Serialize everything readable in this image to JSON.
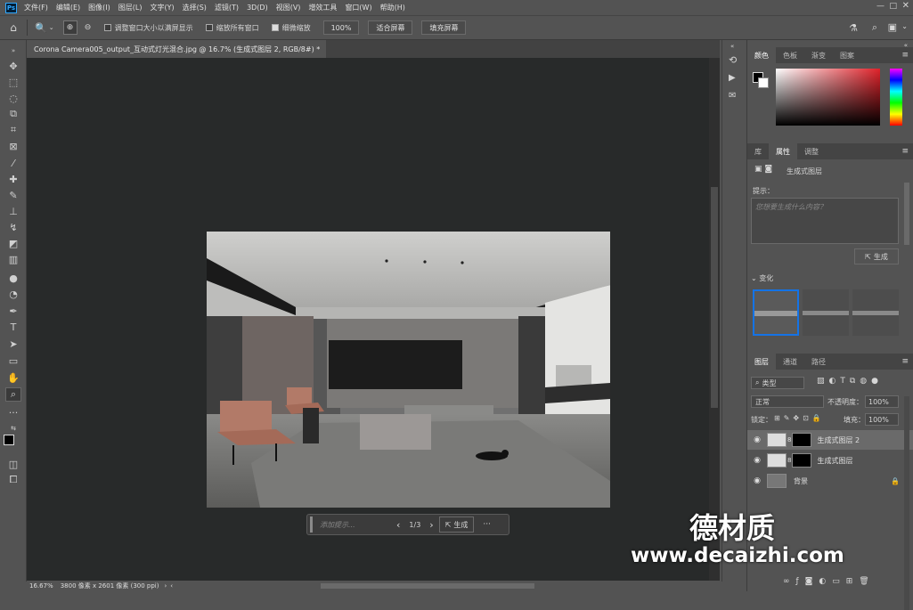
{
  "app": {
    "logo": "Ps"
  },
  "menu": [
    "文件(F)",
    "编辑(E)",
    "图像(I)",
    "图层(L)",
    "文字(Y)",
    "选择(S)",
    "滤镜(T)",
    "3D(D)",
    "视图(V)",
    "增效工具",
    "窗口(W)",
    "帮助(H)"
  ],
  "options": {
    "resize_windows": "调整窗口大小以满屏显示",
    "zoom_all": "缩放所有窗口",
    "scrubby_zoom": "细微缩放",
    "zoom_value": "100%",
    "fit_screen": "适合屏幕",
    "fill_screen": "填充屏幕"
  },
  "document": {
    "tab_title": "Corona Camera005_output_互动式灯光混合.jpg @ 16.7% (生成式图层 2, RGB/8#) *",
    "close": "×"
  },
  "status": {
    "zoom": "16.67%",
    "info": "3800 像素 x 2601 像素 (300 ppi)"
  },
  "genbar": {
    "placeholder": "添加提示...",
    "page": "1/3",
    "generate": "生成",
    "more": "···"
  },
  "color_panel": {
    "tabs": [
      "颜色",
      "色板",
      "渐变",
      "图案"
    ],
    "active": "颜色"
  },
  "props_panel": {
    "tabs": [
      "库",
      "属性",
      "调整"
    ],
    "active": "属性",
    "layer_type": "生成式图层",
    "prompt_label": "提示：",
    "prompt_placeholder": "您想要生成什么内容？",
    "generate": "生成",
    "variations": "变化"
  },
  "layers_panel": {
    "tabs": [
      "图层",
      "通道",
      "路径"
    ],
    "active": "图层",
    "filter_kind": "类型",
    "blend_mode": "正常",
    "opacity_label": "不透明度：",
    "opacity": "100%",
    "lock_label": "锁定：",
    "fill_label": "填充：",
    "fill": "100%",
    "layers": [
      {
        "name": "生成式图层 2",
        "selected": true
      },
      {
        "name": "生成式图层",
        "selected": false
      },
      {
        "name": "背景",
        "selected": false
      }
    ]
  },
  "watermark": {
    "brand": "德材质",
    "url": "www.decaizhi.com"
  },
  "colors": {
    "accent": "#1473e6",
    "canvas": "#282a2a",
    "ui": "#535353"
  }
}
